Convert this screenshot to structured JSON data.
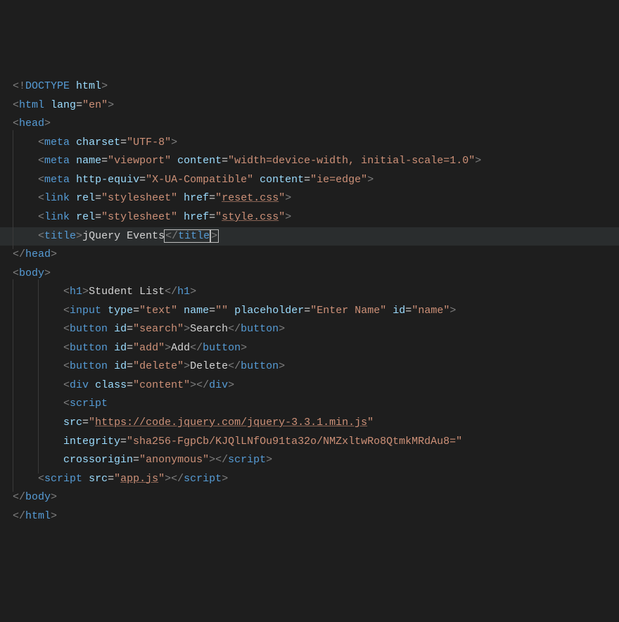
{
  "lines": {
    "l1": {
      "p1": "<!",
      "k": "DOCTYPE",
      "sp": " ",
      "a": "html",
      "p2": ">"
    },
    "l2": {
      "open": "<",
      "tag": "html",
      "sp": " ",
      "attr": "lang",
      "eq": "=",
      "val": "\"en\"",
      "close": ">"
    },
    "l3": {
      "open": "<",
      "tag": "head",
      "close": ">"
    },
    "l4": {
      "pad": "    ",
      "open": "<",
      "tag": "meta",
      "sp": " ",
      "attr": "charset",
      "eq": "=",
      "val": "\"UTF-8\"",
      "close": ">"
    },
    "l5": {
      "pad": "    ",
      "open": "<",
      "tag": "meta",
      "sp": " ",
      "a1": "name",
      "eq1": "=",
      "v1": "\"viewport\"",
      "sp2": " ",
      "a2": "content",
      "eq2": "=",
      "v2": "\"width=device-width, initial-scale=1.0\"",
      "close": ">"
    },
    "l6": {
      "pad": "    ",
      "open": "<",
      "tag": "meta",
      "sp": " ",
      "a1": "http-equiv",
      "eq1": "=",
      "v1": "\"X-UA-Compatible\"",
      "sp2": " ",
      "a2": "content",
      "eq2": "=",
      "v2": "\"ie=edge\"",
      "close": ">"
    },
    "l7": {
      "pad": "    ",
      "open": "<",
      "tag": "link",
      "sp": " ",
      "a1": "rel",
      "eq1": "=",
      "v1": "\"stylesheet\"",
      "sp2": " ",
      "a2": "href",
      "eq2": "=",
      "q": "\"",
      "file": "reset.css",
      "q2": "\"",
      "close": ">"
    },
    "l8": {
      "pad": "    ",
      "open": "<",
      "tag": "link",
      "sp": " ",
      "a1": "rel",
      "eq1": "=",
      "v1": "\"stylesheet\"",
      "sp2": " ",
      "a2": "href",
      "eq2": "=",
      "q": "\"",
      "file": "style.css",
      "q2": "\"",
      "close": ">"
    },
    "l9": {
      "pad": "    ",
      "open": "<",
      "tag": "title",
      "close": ">",
      "text": "jQuery Events",
      "open2": "</",
      "tag2": "title",
      "close2": ">"
    },
    "l10": {
      "open": "</",
      "tag": "head",
      "close": ">"
    },
    "l11": {
      "open": "<",
      "tag": "body",
      "close": ">"
    },
    "l12": {
      "pad": "        ",
      "open": "<",
      "tag": "h1",
      "close": ">",
      "text": "Student List",
      "open2": "</",
      "tag2": "h1",
      "close2": ">"
    },
    "l13": {
      "pad": "        ",
      "open": "<",
      "tag": "input",
      "sp": " ",
      "a1": "type",
      "eq1": "=",
      "v1": "\"text\"",
      "sp2": " ",
      "a2": "name",
      "eq2": "=",
      "v2": "\"\"",
      "sp3": " ",
      "a3": "placeholder",
      "eq3": "=",
      "v3": "\"Enter Name\"",
      "sp4": " ",
      "a4": "id",
      "eq4": "=",
      "v4": "\"name\"",
      "close": ">"
    },
    "l14": {
      "pad": "        ",
      "open": "<",
      "tag": "button",
      "sp": " ",
      "a1": "id",
      "eq1": "=",
      "v1": "\"search\"",
      "close": ">",
      "text": "Search",
      "open2": "</",
      "tag2": "button",
      "close2": ">"
    },
    "l15": {
      "pad": "        ",
      "open": "<",
      "tag": "button",
      "sp": " ",
      "a1": "id",
      "eq1": "=",
      "v1": "\"add\"",
      "close": ">",
      "text": "Add",
      "open2": "</",
      "tag2": "button",
      "close2": ">"
    },
    "l16": {
      "pad": "        ",
      "open": "<",
      "tag": "button",
      "sp": " ",
      "a1": "id",
      "eq1": "=",
      "v1": "\"delete\"",
      "close": ">",
      "text": "Delete",
      "open2": "</",
      "tag2": "button",
      "close2": ">"
    },
    "l17": {
      "pad": "        ",
      "open": "<",
      "tag": "div",
      "sp": " ",
      "a1": "class",
      "eq1": "=",
      "v1": "\"content\"",
      "close": ">",
      "open2": "</",
      "tag2": "div",
      "close2": ">"
    },
    "l18": {
      "pad": "        ",
      "open": "<",
      "tag": "script"
    },
    "l19": {
      "pad": "        ",
      "a1": "src",
      "eq1": "=",
      "q": "\"",
      "url": "https://code.jquery.com/jquery-3.3.1.min.js",
      "q2": "\""
    },
    "l20": {
      "pad": "        ",
      "a1": "integrity",
      "eq1": "=",
      "v1": "\"sha256-FgpCb/KJQlLNfOu91ta32o/NMZxltwRo8QtmkMRdAu8=\""
    },
    "l21": {
      "pad": "        ",
      "a1": "crossorigin",
      "eq1": "=",
      "v1": "\"anonymous\"",
      "close": ">",
      "open2": "</",
      "tag2": "script",
      "close2": ">"
    },
    "l22": {
      "pad": "    ",
      "open": "<",
      "tag": "script",
      "sp": " ",
      "a1": "src",
      "eq1": "=",
      "q": "\"",
      "file": "app.js",
      "q2": "\"",
      "close": ">",
      "open2": "</",
      "tag2": "script",
      "close2": ">"
    },
    "l23": {
      "open": "</",
      "tag": "body",
      "close": ">"
    },
    "l24": {
      "open": "</",
      "tag": "html",
      "close": ">"
    }
  }
}
